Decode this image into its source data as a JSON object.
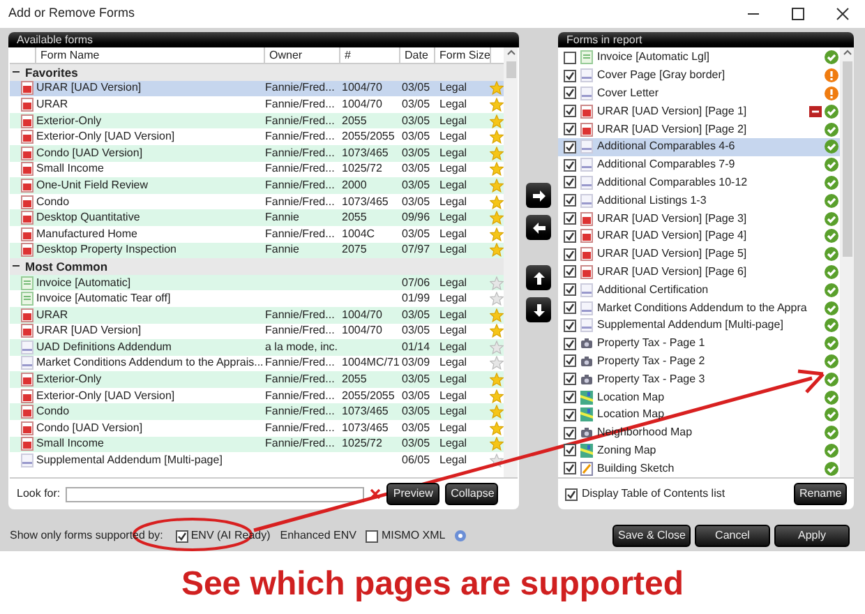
{
  "window": {
    "title": "Add or Remove Forms"
  },
  "available": {
    "title": "Available forms",
    "columns": [
      "Form Name",
      "Owner",
      "#",
      "Date",
      "Form Size"
    ],
    "groups": [
      {
        "name": "Favorites",
        "expanded": true,
        "rows": [
          {
            "kind": "pdf",
            "name": "URAR [UAD Version]",
            "owner": "Fannie/Fred...",
            "number": "1004/70",
            "date": "03/05",
            "size": "Legal",
            "favorite": true,
            "selected": true
          },
          {
            "kind": "pdf",
            "name": "URAR",
            "owner": "Fannie/Fred...",
            "number": "1004/70",
            "date": "03/05",
            "size": "Legal",
            "favorite": true,
            "selected": false
          },
          {
            "kind": "pdf",
            "name": "Exterior-Only",
            "owner": "Fannie/Fred...",
            "number": "2055",
            "date": "03/05",
            "size": "Legal",
            "favorite": true,
            "selected": false
          },
          {
            "kind": "pdf",
            "name": "Exterior-Only [UAD Version]",
            "owner": "Fannie/Fred...",
            "number": "2055/2055",
            "date": "03/05",
            "size": "Legal",
            "favorite": true,
            "selected": false
          },
          {
            "kind": "pdf",
            "name": "Condo [UAD Version]",
            "owner": "Fannie/Fred...",
            "number": "1073/465",
            "date": "03/05",
            "size": "Legal",
            "favorite": true,
            "selected": false
          },
          {
            "kind": "pdf",
            "name": "Small Income",
            "owner": "Fannie/Fred...",
            "number": "1025/72",
            "date": "03/05",
            "size": "Legal",
            "favorite": true,
            "selected": false
          },
          {
            "kind": "pdf",
            "name": "One-Unit Field Review",
            "owner": "Fannie/Fred...",
            "number": "2000",
            "date": "03/05",
            "size": "Legal",
            "favorite": true,
            "selected": false
          },
          {
            "kind": "pdf",
            "name": "Condo",
            "owner": "Fannie/Fred...",
            "number": "1073/465",
            "date": "03/05",
            "size": "Legal",
            "favorite": true,
            "selected": false
          },
          {
            "kind": "pdf",
            "name": "Desktop Quantitative",
            "owner": "Fannie",
            "number": "2055",
            "date": "09/96",
            "size": "Legal",
            "favorite": true,
            "selected": false
          },
          {
            "kind": "pdf",
            "name": "Manufactured Home",
            "owner": "Fannie/Fred...",
            "number": "1004C",
            "date": "03/05",
            "size": "Legal",
            "favorite": true,
            "selected": false
          },
          {
            "kind": "pdf",
            "name": "Desktop Property Inspection",
            "owner": "Fannie",
            "number": "2075",
            "date": "07/97",
            "size": "Legal",
            "favorite": true,
            "selected": false
          }
        ]
      },
      {
        "name": "Most Common",
        "expanded": true,
        "rows": [
          {
            "kind": "invoice",
            "name": "Invoice [Automatic]",
            "date": "07/06",
            "size": "Legal",
            "favorite": false,
            "selected": false
          },
          {
            "kind": "invoice",
            "name": "Invoice [Automatic Tear off]",
            "date": "01/99",
            "size": "Legal",
            "favorite": false,
            "selected": false
          },
          {
            "kind": "pdf",
            "name": "URAR",
            "owner": "Fannie/Fred...",
            "number": "1004/70",
            "date": "03/05",
            "size": "Legal",
            "favorite": true,
            "selected": false
          },
          {
            "kind": "pdf",
            "name": "URAR [UAD Version]",
            "owner": "Fannie/Fred...",
            "number": "1004/70",
            "date": "03/05",
            "size": "Legal",
            "favorite": true,
            "selected": false
          },
          {
            "kind": "addendum",
            "name": "UAD Definitions Addendum",
            "owner": "a la mode, inc.",
            "date": "01/14",
            "size": "Legal",
            "favorite": false,
            "selected": false
          },
          {
            "kind": "addendum",
            "name": "Market Conditions Addendum to the Apprais...",
            "owner": "Fannie/Fred...",
            "number": "1004MC/71",
            "date": "03/09",
            "size": "Legal",
            "favorite": false,
            "selected": false
          },
          {
            "kind": "pdf",
            "name": "Exterior-Only",
            "owner": "Fannie/Fred...",
            "number": "2055",
            "date": "03/05",
            "size": "Legal",
            "favorite": true,
            "selected": false
          },
          {
            "kind": "pdf",
            "name": "Exterior-Only [UAD Version]",
            "owner": "Fannie/Fred...",
            "number": "2055/2055",
            "date": "03/05",
            "size": "Legal",
            "favorite": true,
            "selected": false
          },
          {
            "kind": "pdf",
            "name": "Condo",
            "owner": "Fannie/Fred...",
            "number": "1073/465",
            "date": "03/05",
            "size": "Legal",
            "favorite": true,
            "selected": false
          },
          {
            "kind": "pdf",
            "name": "Condo [UAD Version]",
            "owner": "Fannie/Fred...",
            "number": "1073/465",
            "date": "03/05",
            "size": "Legal",
            "favorite": true,
            "selected": false
          },
          {
            "kind": "pdf",
            "name": "Small Income",
            "owner": "Fannie/Fred...",
            "number": "1025/72",
            "date": "03/05",
            "size": "Legal",
            "favorite": true,
            "selected": false
          },
          {
            "kind": "addendum",
            "name": "Supplemental Addendum [Multi-page]",
            "date": "06/05",
            "size": "Legal",
            "favorite": false,
            "selected": false
          }
        ]
      }
    ],
    "search": {
      "label": "Look for:"
    },
    "buttons": [
      "Preview",
      "Collapse"
    ]
  },
  "report": {
    "title": "Forms in report",
    "items": [
      {
        "kind": "invoice",
        "name": "Invoice [Automatic Lgl]",
        "checked": false,
        "selected": false,
        "warning": false,
        "flagged": false
      },
      {
        "kind": "addendum",
        "name": "Cover Page [Gray border]",
        "checked": true,
        "selected": false,
        "warning": true,
        "flagged": false
      },
      {
        "kind": "addendum",
        "name": "Cover Letter",
        "checked": true,
        "selected": false,
        "warning": true,
        "flagged": false
      },
      {
        "kind": "pdf",
        "name": "URAR [UAD Version] [Page 1]",
        "checked": true,
        "selected": false,
        "warning": false,
        "flagged": true
      },
      {
        "kind": "pdf",
        "name": "URAR [UAD Version] [Page 2]",
        "checked": true,
        "selected": false,
        "warning": false,
        "flagged": false
      },
      {
        "kind": "addendum",
        "name": "Additional Comparables 4-6",
        "checked": true,
        "selected": true,
        "warning": false,
        "flagged": false
      },
      {
        "kind": "addendum",
        "name": "Additional Comparables 7-9",
        "checked": true,
        "selected": false,
        "warning": false,
        "flagged": false
      },
      {
        "kind": "addendum",
        "name": "Additional Comparables 10-12",
        "checked": true,
        "selected": false,
        "warning": false,
        "flagged": false
      },
      {
        "kind": "addendum",
        "name": "Additional Listings 1-3",
        "checked": true,
        "selected": false,
        "warning": false,
        "flagged": false
      },
      {
        "kind": "pdf",
        "name": "URAR [UAD Version] [Page 3]",
        "checked": true,
        "selected": false,
        "warning": false,
        "flagged": false
      },
      {
        "kind": "pdf",
        "name": "URAR [UAD Version] [Page 4]",
        "checked": true,
        "selected": false,
        "warning": false,
        "flagged": false
      },
      {
        "kind": "pdf",
        "name": "URAR [UAD Version] [Page 5]",
        "checked": true,
        "selected": false,
        "warning": false,
        "flagged": false
      },
      {
        "kind": "pdf",
        "name": "URAR [UAD Version] [Page 6]",
        "checked": true,
        "selected": false,
        "warning": false,
        "flagged": false
      },
      {
        "kind": "addendum",
        "name": "Additional Certification",
        "checked": true,
        "selected": false,
        "warning": false,
        "flagged": false
      },
      {
        "kind": "addendum",
        "name": "Market Conditions Addendum to the Appra",
        "checked": true,
        "selected": false,
        "warning": false,
        "flagged": false
      },
      {
        "kind": "addendum",
        "name": "Supplemental Addendum [Multi-page]",
        "checked": true,
        "selected": false,
        "warning": false,
        "flagged": false
      },
      {
        "kind": "camera",
        "name": "Property Tax - Page 1",
        "checked": true,
        "selected": false,
        "warning": false,
        "flagged": false
      },
      {
        "kind": "camera",
        "name": "Property Tax - Page 2",
        "checked": true,
        "selected": false,
        "warning": false,
        "flagged": false
      },
      {
        "kind": "camera",
        "name": "Property Tax - Page 3",
        "checked": true,
        "selected": false,
        "warning": false,
        "flagged": false
      },
      {
        "kind": "map",
        "name": "Location Map",
        "checked": true,
        "selected": false,
        "warning": false,
        "flagged": false
      },
      {
        "kind": "map",
        "name": "Location Map",
        "checked": true,
        "selected": false,
        "warning": false,
        "flagged": false
      },
      {
        "kind": "camera",
        "name": "Neighborhood Map",
        "checked": true,
        "selected": false,
        "warning": false,
        "flagged": false
      },
      {
        "kind": "map",
        "name": "Zoning Map",
        "checked": true,
        "selected": false,
        "warning": false,
        "flagged": false
      },
      {
        "kind": "sketch",
        "name": "Building Sketch",
        "checked": true,
        "selected": false,
        "warning": false,
        "flagged": false
      }
    ],
    "toc": {
      "label": "Display Table of Contents list",
      "checked": true
    },
    "button": "Rename"
  },
  "filter": {
    "label": "Show only forms supported by:",
    "options": [
      {
        "label": "ENV (AI Ready)",
        "checked": true
      },
      {
        "label": "Enhanced ENV"
      },
      {
        "label": "MISMO XML",
        "checked": false
      }
    ]
  },
  "actions": [
    "Save & Close",
    "Cancel",
    "Apply"
  ],
  "caption": "See which pages are supported"
}
